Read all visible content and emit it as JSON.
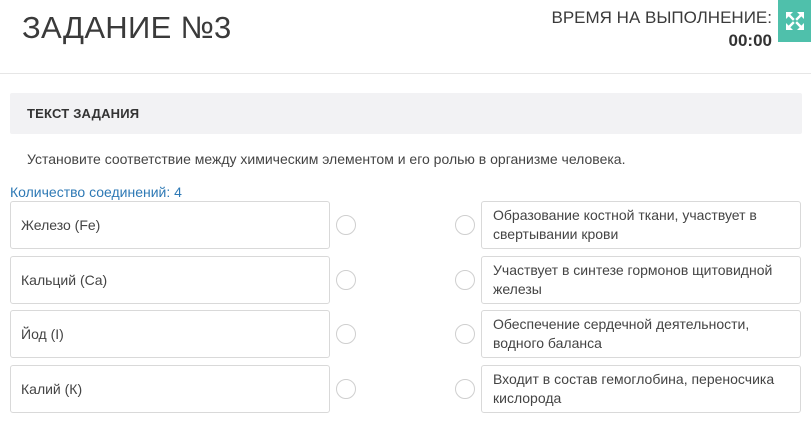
{
  "header": {
    "title": "ЗАДАНИЕ №3",
    "timer_label": "ВРЕМЯ НА ВЫПОЛНЕНИЕ:",
    "timer_value": "00:00",
    "expand_icon": "expand-arrows-icon"
  },
  "task": {
    "section_title": "ТЕКСТ ЗАДАНИЯ",
    "text": "Установите соответствие между химическим элементом и его ролью в организме человека.",
    "connections_count": "Количество соединений: 4"
  },
  "left_items": [
    {
      "label": "Железо (Fe)"
    },
    {
      "label": "Кальций (Ca)"
    },
    {
      "label": "Йод (I)"
    },
    {
      "label": "Калий (К)"
    }
  ],
  "right_items": [
    {
      "label": "Образование костной ткани, участвует в свертывании крови"
    },
    {
      "label": "Участвует в синтезе гормонов щитовидной железы"
    },
    {
      "label": "Обеспечение сердечной деятельности, водного баланса"
    },
    {
      "label": "Входит в состав гемоглобина, переносчика кислорода"
    }
  ],
  "colors": {
    "accent": "#4fc0ab",
    "link": "#2e79b5"
  }
}
